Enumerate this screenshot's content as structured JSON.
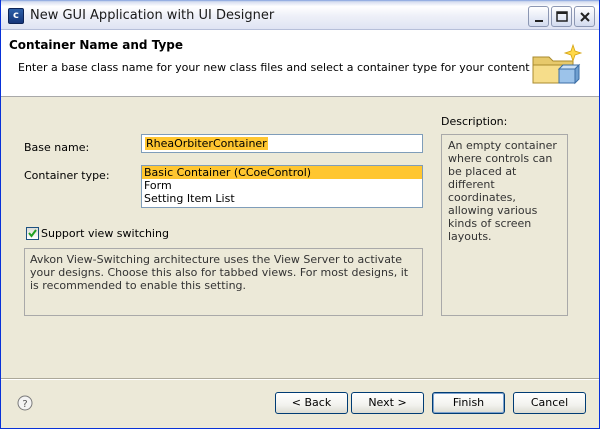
{
  "window": {
    "title": "New GUI Application with UI Designer",
    "icon_letter": "c",
    "controls": [
      "minimize-icon",
      "maximize-icon",
      "close-icon"
    ]
  },
  "banner": {
    "title": "Container Name and Type",
    "description": "Enter a base class name for your new class files and select a container type for your content",
    "icon": "folder-sparkle-icon"
  },
  "form": {
    "base_name_label": "Base name:",
    "base_name_value": "RheaOrbiterContainer",
    "container_type_label": "Container type:",
    "container_types": [
      "Basic Container (CCoeControl)",
      "Form",
      "Setting Item List"
    ],
    "selected_container_type": "Basic Container (CCoeControl)",
    "support_view_switching_label": "Support view switching",
    "support_view_switching_checked": true,
    "view_switching_info": "Avkon View-Switching architecture uses the View Server to activate your designs. Choose this also for tabbed views. For most designs, it is recommended to enable this setting."
  },
  "description": {
    "heading": "Description:",
    "text": "An empty container where controls can be placed at different coordinates, allowing various kinds of screen layouts."
  },
  "footer": {
    "help_icon": "help-icon",
    "back_label": "< Back",
    "next_label": "Next >",
    "finish_label": "Finish",
    "cancel_label": "Cancel"
  },
  "colors": {
    "selection": "#ffc630",
    "dialog_bg": "#ece9d8",
    "border": "#7f9db9"
  }
}
